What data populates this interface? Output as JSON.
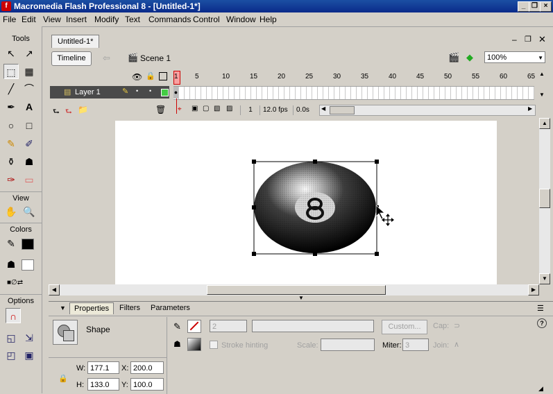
{
  "titlebar": {
    "title": "Macromedia Flash Professional 8 - [Untitled-1*]",
    "logo": "f",
    "minimize": "_",
    "restore": "❐",
    "close": "×"
  },
  "menu": [
    "File",
    "Edit",
    "View",
    "Insert",
    "Modify",
    "Text",
    "Commands",
    "Control",
    "Window",
    "Help"
  ],
  "tools": {
    "header": "Tools",
    "view_header": "View",
    "colors_header": "Colors",
    "options_header": "Options"
  },
  "document": {
    "tab": "Untitled-1*",
    "timeline_button": "Timeline",
    "scene": "Scene 1",
    "zoom": "100%"
  },
  "timeline": {
    "layer_name": "Layer 1",
    "ruler": [
      "1",
      "5",
      "10",
      "15",
      "20",
      "25",
      "30",
      "35",
      "40",
      "45",
      "50",
      "55",
      "60",
      "65"
    ],
    "frame": "1",
    "fps": "12.0 fps",
    "time": "0.0s"
  },
  "properties": {
    "tabs": [
      "Properties",
      "Filters",
      "Parameters"
    ],
    "type": "Shape",
    "stroke_height": "2",
    "custom_btn": "Custom...",
    "cap": "Cap:",
    "stroke_hinting": "Stroke hinting",
    "scale": "Scale:",
    "miter_label": "Miter:",
    "miter": "3",
    "join": "Join:",
    "w_label": "W:",
    "w": "177.1",
    "h_label": "H:",
    "h": "133.0",
    "x_label": "X:",
    "x": "200.0",
    "y_label": "Y:",
    "y": "100.0"
  },
  "colors": {
    "accent": "#0a2a8a",
    "layer_row": "#4a4a4a",
    "playhead": "#e03030"
  }
}
